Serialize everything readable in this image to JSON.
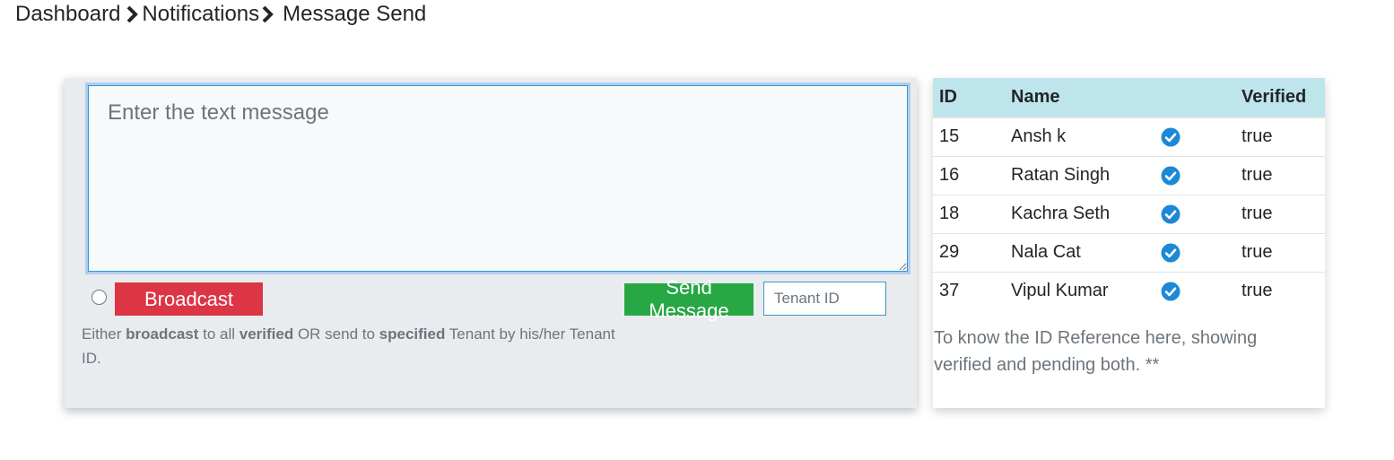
{
  "breadcrumb": {
    "items": [
      "Dashboard",
      "Notifications",
      "Message Send"
    ]
  },
  "compose": {
    "message_placeholder": "Enter the text message",
    "broadcast_label": "Broadcast",
    "broadcast_selected": false,
    "send_label": "Send Message",
    "tenant_placeholder": "Tenant ID",
    "help": {
      "t1": "Either ",
      "b1": "broadcast",
      "t2": " to all ",
      "b2": "verified",
      "t3": " OR send to ",
      "b3": "specified",
      "t4": " Tenant by his/her Tenant ID."
    }
  },
  "reference": {
    "headers": {
      "id": "ID",
      "name": "Name",
      "verified": "Verified"
    },
    "rows": [
      {
        "id": "15",
        "name": "Ansh k",
        "icon": "check-circle-icon",
        "verified": "true"
      },
      {
        "id": "16",
        "name": "Ratan Singh",
        "icon": "check-circle-icon",
        "verified": "true"
      },
      {
        "id": "18",
        "name": "Kachra Seth",
        "icon": "check-circle-icon",
        "verified": "true"
      },
      {
        "id": "29",
        "name": "Nala Cat",
        "icon": "check-circle-icon",
        "verified": "true"
      },
      {
        "id": "37",
        "name": "Vipul Kumar",
        "icon": "check-circle-icon",
        "verified": "true"
      }
    ],
    "note": "To know the ID Reference here, showing verified and pending both. **"
  },
  "colors": {
    "broadcast": "#dc3545",
    "send": "#28a745",
    "table_header": "#bee5eb",
    "check_icon": "#1e88d8",
    "compose_bg": "#e9ecef"
  }
}
